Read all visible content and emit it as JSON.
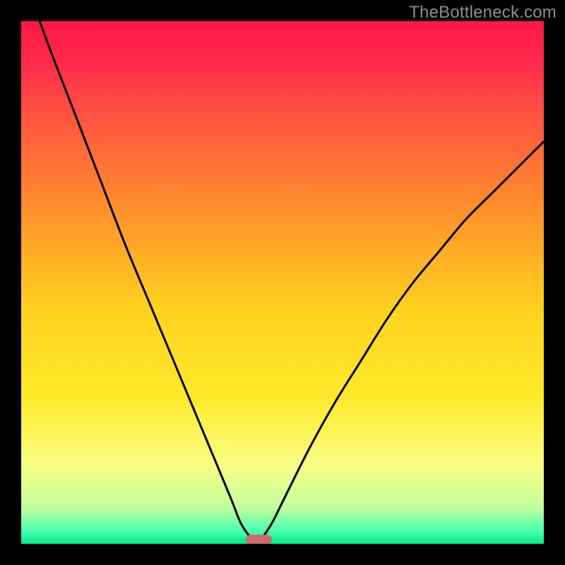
{
  "watermark": "TheBottleneck.com",
  "chart_data": {
    "type": "line",
    "title": "",
    "xlabel": "",
    "ylabel": "",
    "xlim": [
      0,
      100
    ],
    "ylim": [
      0,
      100
    ],
    "grid": false,
    "legend": false,
    "series": [
      {
        "name": "bottleneck-curve",
        "x": [
          0,
          5,
          10,
          15,
          20,
          25,
          30,
          35,
          40,
          42,
          44,
          45,
          46,
          48,
          50,
          55,
          60,
          65,
          70,
          75,
          80,
          85,
          90,
          95,
          100
        ],
        "y": [
          110,
          96,
          83,
          70,
          57,
          45,
          33,
          21,
          9,
          4,
          1,
          0,
          1,
          4,
          8,
          18,
          27,
          35,
          43,
          50,
          56,
          62,
          67,
          72,
          77
        ]
      }
    ],
    "optimal_marker": {
      "x_start": 43,
      "x_end": 48,
      "y": 0
    },
    "background_gradient_stops": [
      {
        "offset": 0.0,
        "color": "#ff1744"
      },
      {
        "offset": 0.08,
        "color": "#ff2b4a"
      },
      {
        "offset": 0.2,
        "color": "#ff5a3e"
      },
      {
        "offset": 0.35,
        "color": "#ff8c2d"
      },
      {
        "offset": 0.55,
        "color": "#ffd21f"
      },
      {
        "offset": 0.72,
        "color": "#ffe92a"
      },
      {
        "offset": 0.85,
        "color": "#f7ff84"
      },
      {
        "offset": 0.93,
        "color": "#c4ff9e"
      },
      {
        "offset": 0.975,
        "color": "#4bffb0"
      },
      {
        "offset": 1.0,
        "color": "#00e988"
      }
    ]
  }
}
